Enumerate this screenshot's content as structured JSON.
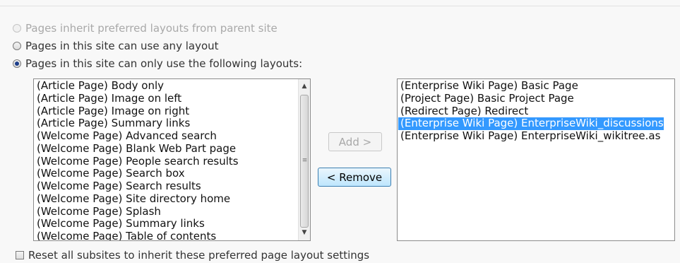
{
  "radios": [
    {
      "label": "Pages inherit preferred layouts from parent site",
      "checked": false,
      "disabled": true
    },
    {
      "label": "Pages in this site can use any layout",
      "checked": false,
      "disabled": false
    },
    {
      "label": "Pages in this site can only use the following layouts:",
      "checked": true,
      "disabled": false
    }
  ],
  "available_layouts": [
    "(Article Page) Body only",
    "(Article Page) Image on left",
    "(Article Page) Image on right",
    "(Article Page) Summary links",
    "(Welcome Page) Advanced search",
    "(Welcome Page) Blank Web Part page",
    "(Welcome Page) People search results",
    "(Welcome Page) Search box",
    "(Welcome Page) Search results",
    "(Welcome Page) Site directory home",
    "(Welcome Page) Splash",
    "(Welcome Page) Summary links",
    "(Welcome Page) Table of contents"
  ],
  "buttons": {
    "add": "Add >",
    "remove": "< Remove"
  },
  "selected_layouts": [
    {
      "label": "(Enterprise Wiki Page) Basic Page",
      "selected": false
    },
    {
      "label": "(Project Page) Basic Project Page",
      "selected": false
    },
    {
      "label": "(Redirect Page) Redirect",
      "selected": false
    },
    {
      "label": "(Enterprise Wiki Page) EnterpriseWiki_discussions",
      "selected": true
    },
    {
      "label": "(Enterprise Wiki Page) EnterpriseWiki_wikitree.as",
      "selected": false
    }
  ],
  "reset_checkbox": {
    "label": "Reset all subsites to inherit these preferred page layout settings",
    "checked": false
  },
  "colors": {
    "selection": "#3399ff",
    "radio_dot": "#1c3d8a"
  }
}
